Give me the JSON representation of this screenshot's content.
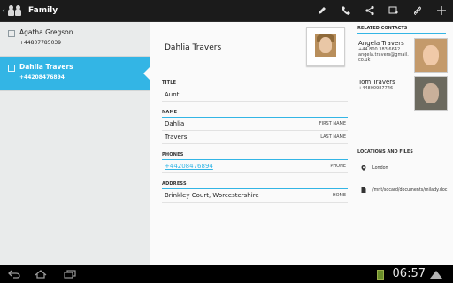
{
  "actionbar": {
    "title": "Family",
    "actions": [
      "edit-icon",
      "phone-icon",
      "share-icon",
      "new-contact-icon",
      "attach-icon",
      "add-icon"
    ]
  },
  "list": {
    "items": [
      {
        "name": "Agatha Gregson",
        "phone": "+44807785039",
        "selected": false
      },
      {
        "name": "Dahlia Travers",
        "phone": "+44208476894",
        "selected": true
      }
    ]
  },
  "detail": {
    "full_name": "Dahlia Travers",
    "title": {
      "header": "TITLE",
      "value": "Aunt"
    },
    "name": {
      "header": "NAME",
      "rows": [
        {
          "value": "Dahlia",
          "type": "FIRST NAME"
        },
        {
          "value": "Travers",
          "type": "LAST NAME"
        }
      ]
    },
    "phones": {
      "header": "PHONES",
      "rows": [
        {
          "value": "+44208476894",
          "type": "PHONE"
        }
      ]
    },
    "address": {
      "header": "ADDRESS",
      "rows": [
        {
          "value": "Brinkley Court, Worcestershire",
          "type": "HOME"
        }
      ]
    }
  },
  "related": {
    "header": "RELATED CONTACTS",
    "contacts": [
      {
        "name": "Angela Travers",
        "lines": [
          "+44 800 383 6642",
          "angela.travers@gmail.",
          "co.uk"
        ]
      },
      {
        "name": "Tom Travers",
        "lines": [
          "+44800987746"
        ]
      }
    ]
  },
  "locations": {
    "header": "LOCATIONS AND FILES",
    "items": [
      {
        "icon": "location-pin-icon",
        "text": "London"
      },
      {
        "icon": "file-icon",
        "text": "/mnt/sdcard/documents/milady.doc"
      }
    ]
  },
  "statusbar": {
    "time": "06:57"
  },
  "colors": {
    "accent": "#33b5e5",
    "bar": "#1b1b1b"
  }
}
